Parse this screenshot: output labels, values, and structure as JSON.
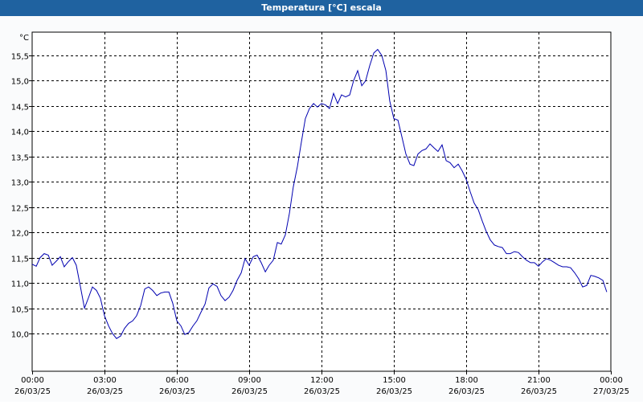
{
  "window": {
    "title": "Temperatura [°C] escala"
  },
  "chart_data": {
    "type": "line",
    "title": "Temperatura [°C] escala",
    "ylabel": "°C",
    "xlabel": "",
    "ylim": [
      9.5,
      16.0
    ],
    "xlim": [
      0,
      24
    ],
    "y_ticks": [
      "10,0",
      "10,5",
      "11,0",
      "11,5",
      "12,0",
      "12,5",
      "13,0",
      "13,5",
      "14,0",
      "14,5",
      "15,0",
      "15,5"
    ],
    "y_tick_values": [
      10.0,
      10.5,
      11.0,
      11.5,
      12.0,
      12.5,
      13.0,
      13.5,
      14.0,
      14.5,
      15.0,
      15.5
    ],
    "x_ticks": [
      {
        "time": "00:00",
        "date": "26/03/25"
      },
      {
        "time": "03:00",
        "date": "26/03/25"
      },
      {
        "time": "06:00",
        "date": "26/03/25"
      },
      {
        "time": "09:00",
        "date": "26/03/25"
      },
      {
        "time": "12:00",
        "date": "26/03/25"
      },
      {
        "time": "15:00",
        "date": "26/03/25"
      },
      {
        "time": "18:00",
        "date": "26/03/25"
      },
      {
        "time": "21:00",
        "date": "26/03/25"
      },
      {
        "time": "00:00",
        "date": "27/03/25"
      }
    ],
    "grid": true,
    "line_color": "#0000b0",
    "series": [
      {
        "x": [
          0.0,
          0.17,
          0.33,
          0.5,
          0.67,
          0.83,
          1.0,
          1.17,
          1.33,
          1.5,
          1.67,
          1.83,
          2.0,
          2.17,
          2.33,
          2.5,
          2.67,
          2.83,
          3.0,
          3.17,
          3.33,
          3.5,
          3.67,
          3.83,
          4.0,
          4.17,
          4.33,
          4.5,
          4.67,
          4.83,
          5.0,
          5.17,
          5.33,
          5.5,
          5.67,
          5.83,
          6.0,
          6.17,
          6.33,
          6.5,
          6.67,
          6.83,
          7.0,
          7.17,
          7.33,
          7.5,
          7.67,
          7.83,
          8.0,
          8.17,
          8.33,
          8.5,
          8.67,
          8.83,
          9.0,
          9.17,
          9.33,
          9.5,
          9.67,
          9.83,
          10.0,
          10.17,
          10.33,
          10.5,
          10.67,
          10.83,
          11.0,
          11.17,
          11.33,
          11.5,
          11.67,
          11.83,
          12.0,
          12.17,
          12.33,
          12.5,
          12.67,
          12.83,
          13.0,
          13.17,
          13.33,
          13.5,
          13.67,
          13.83,
          14.0,
          14.17,
          14.33,
          14.5,
          14.67,
          14.83,
          15.0,
          15.17,
          15.33,
          15.5,
          15.67,
          15.83,
          16.0,
          16.17,
          16.33,
          16.5,
          16.67,
          16.83,
          17.0,
          17.17,
          17.33,
          17.5,
          17.67,
          17.83,
          18.0,
          18.17,
          18.33,
          18.5,
          18.67,
          18.83,
          19.0,
          19.17,
          19.33,
          19.5,
          19.67,
          19.83,
          20.0,
          20.17,
          20.33,
          20.5,
          20.67,
          20.83,
          21.0,
          21.17,
          21.33,
          21.5,
          21.67,
          21.83,
          22.0,
          22.17,
          22.33,
          22.5,
          22.67,
          22.83,
          23.0,
          23.17,
          23.33,
          23.5,
          23.67,
          23.83
        ],
        "y": [
          11.37,
          11.33,
          11.5,
          11.58,
          11.55,
          11.35,
          11.43,
          11.52,
          11.32,
          11.42,
          11.5,
          11.35,
          10.93,
          10.5,
          10.7,
          10.92,
          10.85,
          10.7,
          10.35,
          10.15,
          10.0,
          9.9,
          9.95,
          10.1,
          10.2,
          10.25,
          10.35,
          10.55,
          10.88,
          10.92,
          10.85,
          10.75,
          10.8,
          10.82,
          10.82,
          10.6,
          10.25,
          10.15,
          9.98,
          10.02,
          10.15,
          10.25,
          10.42,
          10.58,
          10.9,
          10.98,
          10.93,
          10.75,
          10.65,
          10.72,
          10.85,
          11.05,
          11.2,
          11.48,
          11.35,
          11.52,
          11.55,
          11.4,
          11.22,
          11.35,
          11.45,
          11.8,
          11.77,
          11.95,
          12.38,
          12.9,
          13.3,
          13.8,
          14.25,
          14.45,
          14.55,
          14.48,
          14.55,
          14.52,
          14.45,
          14.75,
          14.55,
          14.72,
          14.68,
          14.72,
          15.0,
          15.2,
          14.9,
          15.0,
          15.3,
          15.55,
          15.62,
          15.5,
          15.2,
          14.6,
          14.25,
          14.22,
          13.9,
          13.55,
          13.35,
          13.32,
          13.55,
          13.62,
          13.65,
          13.75,
          13.67,
          13.6,
          13.73,
          13.42,
          13.38,
          13.28,
          13.35,
          13.22,
          13.05,
          12.8,
          12.58,
          12.45,
          12.22,
          12.02,
          11.85,
          11.75,
          11.72,
          11.7,
          11.58,
          11.58,
          11.62,
          11.6,
          11.52,
          11.45,
          11.4,
          11.4,
          11.33,
          11.42,
          11.48,
          11.45,
          11.4,
          11.35,
          11.32,
          11.32,
          11.3,
          11.2,
          11.08,
          10.92,
          10.95,
          11.15,
          11.13,
          11.1,
          11.05,
          10.82
        ]
      }
    ]
  }
}
